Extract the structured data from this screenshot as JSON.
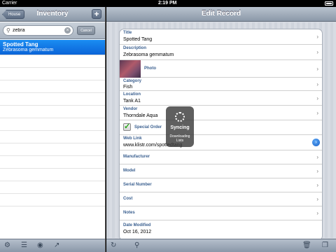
{
  "status_bar": {
    "carrier": "Carrier",
    "time": "2:19 PM"
  },
  "left_pane": {
    "back_label": "House",
    "title": "Inventory",
    "add_symbol": "+",
    "search": {
      "value": "zebra",
      "cancel_label": "Cancel"
    },
    "results": [
      {
        "name": "Spotted Tang",
        "sub": "Zebrasoma gemmatum",
        "selected": true
      }
    ]
  },
  "right_pane": {
    "title": "Edit Record",
    "fields": {
      "title_label": "Title",
      "title_value": "Spotted Tang",
      "description_label": "Description",
      "description_value": "Zebrasoma gemmatum",
      "photo_label": "Photo",
      "category_label": "Category",
      "category_value": "Fish",
      "location_label": "Location",
      "location_value": "Tank A1",
      "vendor_label": "Vendor",
      "vendor_value": "Thorndale Aqua",
      "special_order_label": "Special Order",
      "weblink_label": "Web Link",
      "weblink_value": "www.klistr.com/spottedtang",
      "manufacturer_label": "Manufacturer",
      "model_label": "Model",
      "serial_label": "Serial Number",
      "cost_label": "Cost",
      "notes_label": "Notes",
      "date_modified_label": "Date Modified",
      "date_modified_value": "Oct 16, 2012"
    }
  },
  "hud": {
    "title": "Syncing",
    "subtitle": "Downloading Lists"
  }
}
